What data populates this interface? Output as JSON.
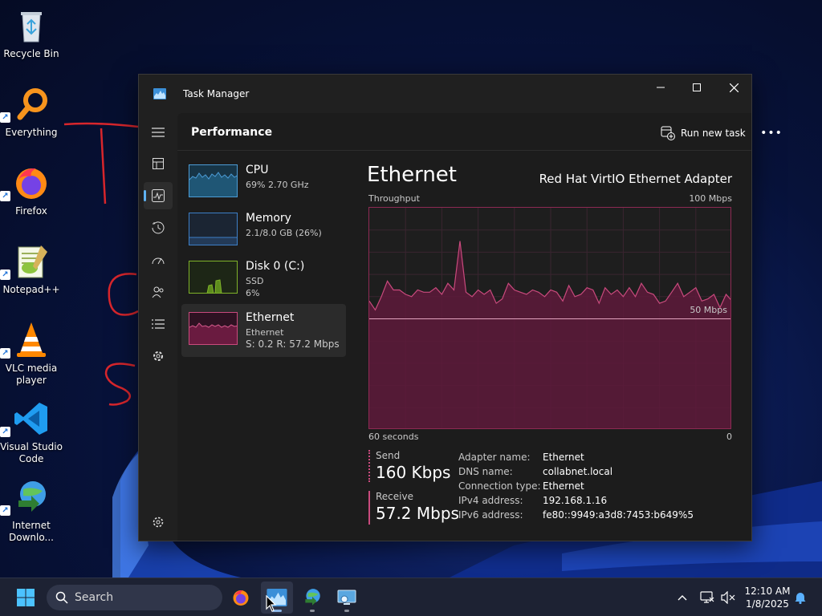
{
  "desktop": {
    "icons": [
      {
        "label": "Recycle Bin",
        "icon": "recycle-bin-icon"
      },
      {
        "label": "Everything",
        "icon": "everything-search-icon"
      },
      {
        "label": "Firefox",
        "icon": "firefox-icon"
      },
      {
        "label": "Notepad++",
        "icon": "notepad-plus-plus-icon"
      },
      {
        "label": "VLC media player",
        "icon": "vlc-icon"
      },
      {
        "label": "Visual Studio Code",
        "icon": "vscode-icon"
      },
      {
        "label": "Internet Downlo...",
        "icon": "internet-download-manager-icon"
      }
    ]
  },
  "window": {
    "title": "Task Manager",
    "controls": {
      "minimize": "minimize-icon",
      "maximize": "maximize-icon",
      "close": "close-icon"
    }
  },
  "nav": {
    "items": [
      "hamburger-menu-icon",
      "processes-icon",
      "performance-icon",
      "app-history-icon",
      "startup-apps-icon",
      "users-icon",
      "details-icon",
      "services-icon"
    ],
    "active": "performance-icon",
    "settings": "settings-icon"
  },
  "header": {
    "title": "Performance",
    "run_task": "Run new task",
    "more": "more-options-icon"
  },
  "perf_list": [
    {
      "name": "CPU",
      "sub1": "69%  2.70 GHz",
      "sub2": "",
      "color": "#4c9cd6"
    },
    {
      "name": "Memory",
      "sub1": "2.1/8.0 GB (26%)",
      "sub2": "",
      "color": "#3d7fc7"
    },
    {
      "name": "Disk 0 (C:)",
      "sub1": "SSD",
      "sub2": "6%",
      "color": "#7fb329"
    },
    {
      "name": "Ethernet",
      "sub1": "Ethernet",
      "sub2": "S: 0.2  R: 57.2 Mbps",
      "color": "#c94a7d"
    }
  ],
  "selected_item": "Ethernet",
  "detail": {
    "title": "Ethernet",
    "adapter": "Red Hat VirtIO Ethernet Adapter",
    "throughput_label": "Throughput",
    "max_label": "100 Mbps",
    "half_label": "50 Mbps",
    "time_label": "60 seconds",
    "zero_label": "0",
    "send_label": "Send",
    "send_value": "160 Kbps",
    "receive_label": "Receive",
    "receive_value": "57.2 Mbps",
    "properties": [
      {
        "key": "Adapter name:",
        "value": "Ethernet"
      },
      {
        "key": "DNS name:",
        "value": "collabnet.local"
      },
      {
        "key": "Connection type:",
        "value": "Ethernet"
      },
      {
        "key": "IPv4 address:",
        "value": "192.168.1.16"
      },
      {
        "key": "IPv6 address:",
        "value": "fe80::9949:a3d8:7453:b649%5"
      }
    ]
  },
  "chart_data": {
    "type": "area",
    "title": "",
    "xlabel": "60 seconds",
    "ylabel": "Throughput",
    "xlim": [
      60,
      0
    ],
    "ylim": [
      0,
      100
    ],
    "grid": true,
    "series": [
      {
        "values": [
          58,
          54,
          60,
          67,
          63,
          63,
          61,
          60,
          63,
          62,
          62,
          64,
          61,
          66,
          63,
          85,
          62,
          60,
          63,
          61,
          63,
          57,
          59,
          66,
          63,
          62,
          61,
          63,
          62,
          60,
          63,
          62,
          58,
          65,
          60,
          61,
          64,
          63,
          57,
          64,
          61,
          63,
          60,
          64,
          60,
          66,
          62,
          61,
          57,
          58,
          62,
          66,
          60,
          62,
          64,
          58,
          59,
          61,
          55,
          61,
          58
        ]
      },
      {
        "values": [
          50,
          50,
          50,
          50,
          50,
          50,
          50,
          50,
          50,
          50,
          50,
          50,
          50,
          50,
          50,
          50,
          50,
          50,
          50,
          50,
          50,
          50,
          50,
          50,
          50,
          50,
          50,
          50,
          50,
          50,
          50,
          50,
          50,
          50,
          50,
          50,
          50,
          50,
          50,
          50,
          50,
          50,
          50,
          50,
          50,
          50,
          50,
          50,
          50,
          50,
          50,
          50,
          50,
          50,
          50,
          50,
          50,
          50,
          50,
          50,
          50
        ]
      }
    ]
  },
  "taskbar": {
    "search_placeholder": "Search",
    "apps": [
      "start-icon",
      "firefox-icon",
      "task-manager-icon",
      "internet-download-manager-icon",
      "remote-desktop-icon"
    ],
    "tray": [
      "show-hidden-icons-chevron",
      "network-icon",
      "volume-muted-icon",
      "notifications-bell-icon"
    ],
    "time": "12:10 AM",
    "date": "1/8/2025"
  }
}
